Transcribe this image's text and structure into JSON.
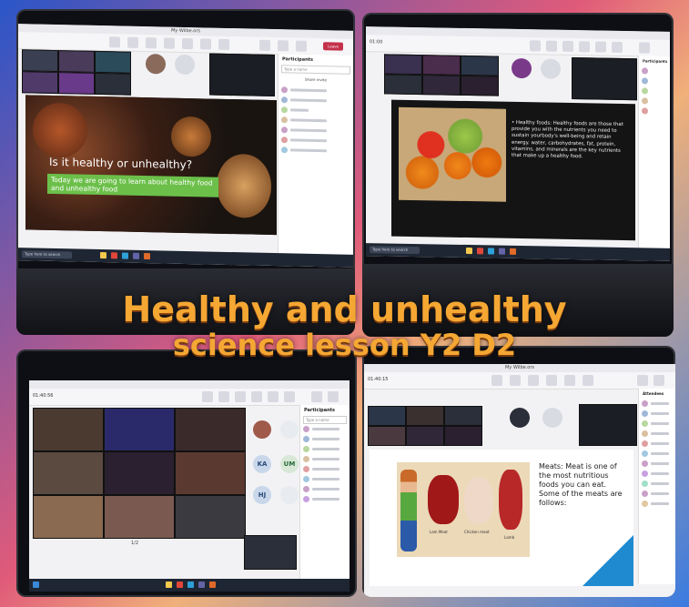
{
  "collage": {
    "caption_line1": "Healthy and unhealthy",
    "caption_line2": "science lesson Y2 D2",
    "accent": "#f5a733"
  },
  "panel1": {
    "window_title": "My Wilbe.ors",
    "leave_label": "Leave",
    "participants_title": "Participants",
    "search_placeholder": "Type a name",
    "share_invite": "Share invite",
    "slide_title": "Is it healthy or unhealthy?",
    "slide_subtitle": "Today we are going to learn about healthy food and unhealthy food",
    "taskbar_search": "Type here to search"
  },
  "panel2": {
    "timer": "01:00",
    "participants_title": "Participants",
    "slide_text": "• Healthy foods: Healthy foods are those that provide you with the nutrients you need to sustain yourbody's well-being and retain energy. water, carbohydrates, fat, protein, vitamins, and minerals are the key nutrients that make up a healthy food.",
    "taskbar_search": "Type here to search"
  },
  "panel3": {
    "timer": "01:40:56",
    "participants_title": "Participants",
    "search_placeholder": "Type a name",
    "avatars": [
      "KA",
      "UM",
      "HJ"
    ],
    "page_indicator": "1/2"
  },
  "panel4": {
    "timer": "01:40:15",
    "window_title": "My Wilbe.ors",
    "attendees_title": "Attendees",
    "slide_text": "Meats: Meat is one of the most nutritious foods you can eat. Some of the meats are follows:",
    "meat_labels": [
      "Lam Meat",
      "Chicken meat",
      "Lamb"
    ]
  }
}
